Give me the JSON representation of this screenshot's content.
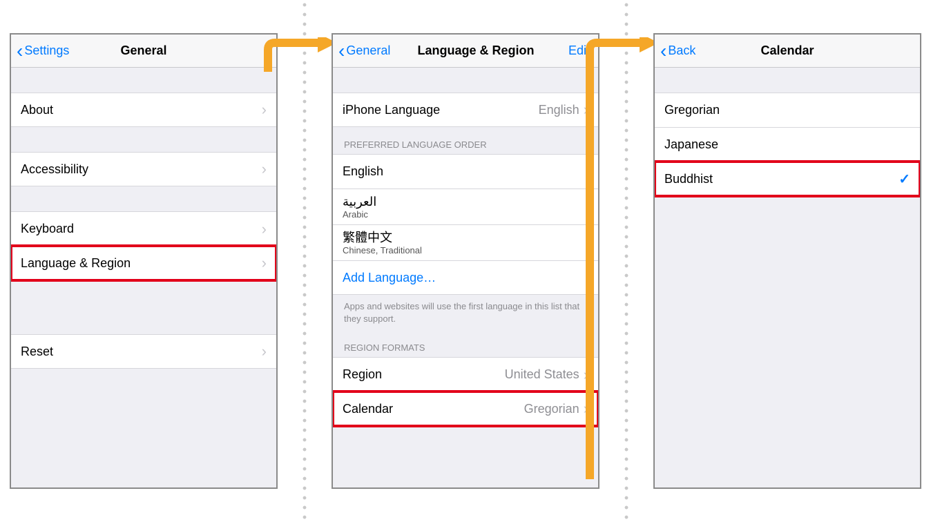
{
  "panel1": {
    "back_label": "Settings",
    "title": "General",
    "rows": {
      "about": "About",
      "accessibility": "Accessibility",
      "keyboard": "Keyboard",
      "language_region": "Language & Region",
      "reset": "Reset"
    }
  },
  "panel2": {
    "back_label": "General",
    "title": "Language & Region",
    "edit": "Edit",
    "iphone_language_label": "iPhone Language",
    "iphone_language_value": "English",
    "pref_header": "PREFERRED LANGUAGE ORDER",
    "langs": [
      {
        "native": "English",
        "sub": ""
      },
      {
        "native": "العربية",
        "sub": "Arabic"
      },
      {
        "native": "繁體中文",
        "sub": "Chinese, Traditional"
      }
    ],
    "add_language": "Add Language…",
    "pref_footer": "Apps and websites will use the first language in this list that they support.",
    "region_header": "REGION FORMATS",
    "region_label": "Region",
    "region_value": "United States",
    "calendar_label": "Calendar",
    "calendar_value": "Gregorian"
  },
  "panel3": {
    "back_label": "Back",
    "title": "Calendar",
    "options": [
      {
        "label": "Gregorian",
        "selected": false
      },
      {
        "label": "Japanese",
        "selected": false
      },
      {
        "label": "Buddhist",
        "selected": true
      }
    ]
  }
}
